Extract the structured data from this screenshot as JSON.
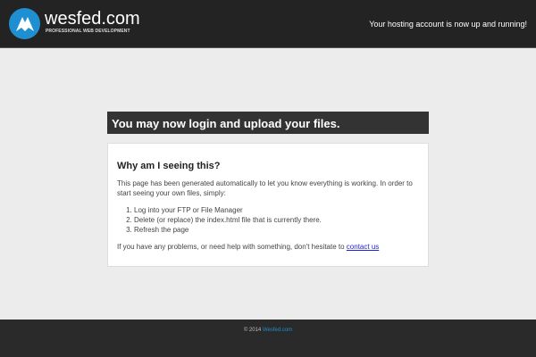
{
  "header": {
    "brand": "wesfed.com",
    "tagline": "PROFESSIONAL WEB DEVELOPMENT",
    "message": "Your hosting account is now up and running!"
  },
  "banner": "You may now login and upload your files.",
  "content": {
    "heading": "Why am I seeing this?",
    "intro": "This page has been generated automatically to let you know everything is working. In order to start seeing your own files, simply:",
    "steps": [
      "Log into your FTP or File Manager",
      "Delete (or replace) the index.html file that is currently there.",
      "Refresh the page"
    ],
    "help": "If you have any problems, or need help with something, don't hesitate to ",
    "contact_link": "contact us"
  },
  "footer": {
    "copyright": "© 2014 ",
    "link": "Wesfed.com"
  }
}
